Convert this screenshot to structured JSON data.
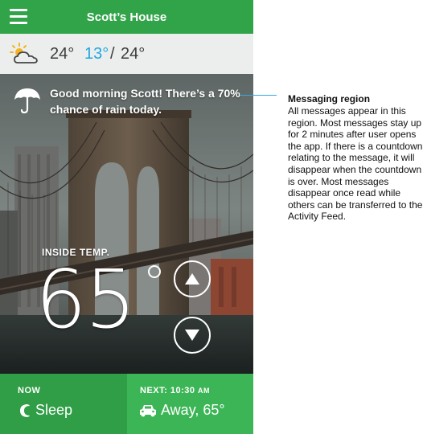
{
  "header": {
    "title": "Scott’s House"
  },
  "weather": {
    "current": "24°",
    "low": "13°",
    "separator": "/",
    "high": "24°",
    "icon": "partly-sunny-icon"
  },
  "message": {
    "icon": "umbrella-icon",
    "text": "Good morning Scott! There’s a 70% chance of rain today."
  },
  "thermostat": {
    "label": "INSIDE TEMP.",
    "value": "65"
  },
  "bottom": {
    "now_label": "NOW",
    "now_value": "Sleep",
    "next_label": "NEXT: 10:30",
    "next_label_suffix": "AM",
    "next_value": "Away, 65°"
  },
  "annotation": {
    "title": "Messaging region",
    "body": "All messages appear in this region. Most messages stay up for 2 minutes after user opens the app. If there is a countdown relating to the message, it will disappear when the countdown is over. Most messages disappear once read while others can be transferred to the Activity Feed."
  },
  "colors": {
    "brand_green": "#31a44a",
    "accent_blue": "#1ea7e0",
    "callout_line": "#35a9db"
  }
}
